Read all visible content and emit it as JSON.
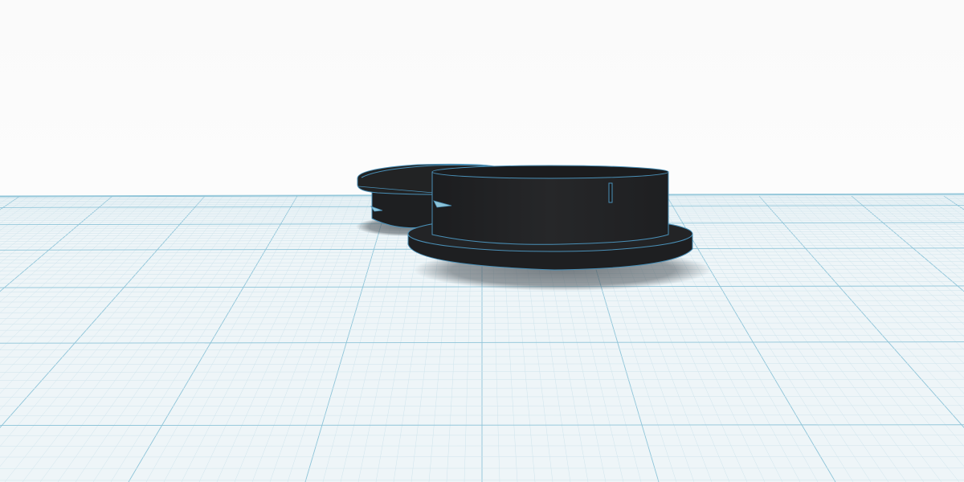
{
  "viewport": {
    "kind": "3d-modeling-canvas"
  },
  "colors": {
    "sky": "#ffffff",
    "workplane": "#eef5f8",
    "grid_minor": "#cfe4ec",
    "grid_major": "#8ec4d8",
    "model_fill": "#222324",
    "model_top": "#1e1f21",
    "model_edge": "#4a8fb6",
    "shadow": "#4e565c"
  },
  "workplane": {
    "grid": true
  },
  "scene_objects": [
    {
      "id": "rear-cap",
      "type": "cylinder",
      "color": "black",
      "selected": false
    },
    {
      "id": "front-cap",
      "type": "flanged-cylinder",
      "color": "black",
      "selected": false
    }
  ]
}
